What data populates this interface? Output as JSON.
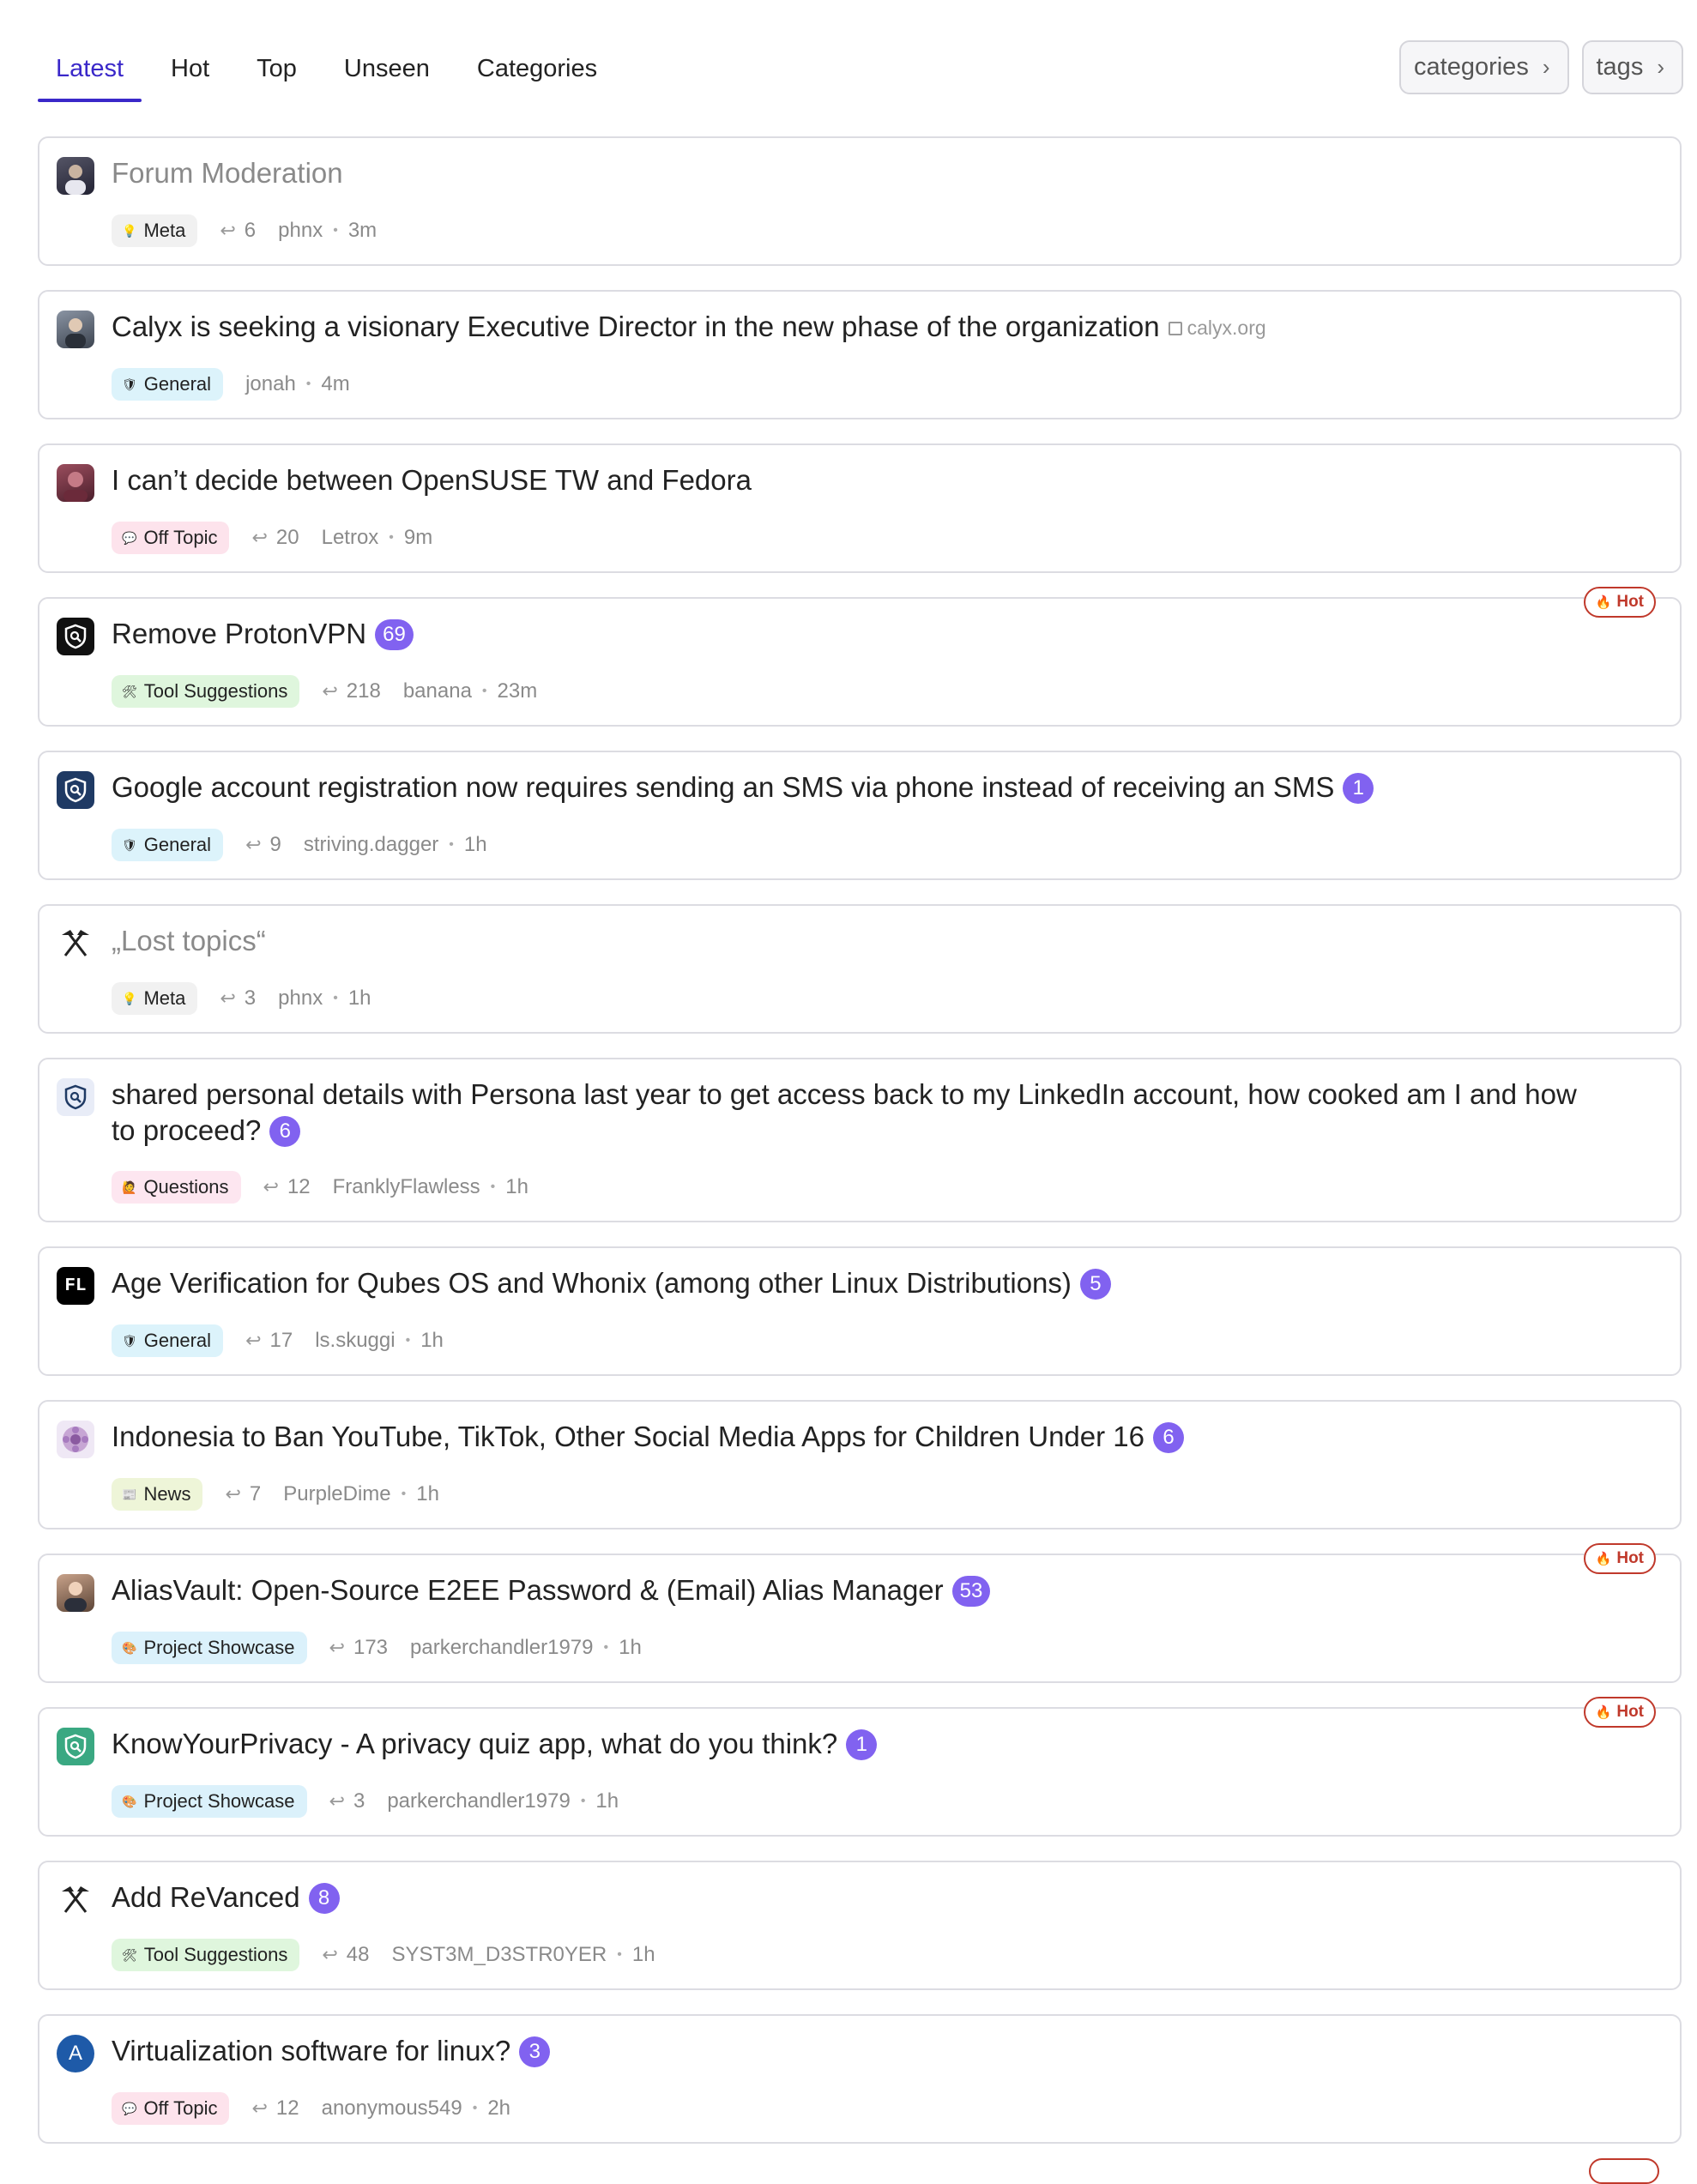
{
  "nav": {
    "tabs": [
      "Latest",
      "Hot",
      "Top",
      "Unseen",
      "Categories"
    ],
    "active_tab": "Latest",
    "filters": {
      "categories": "categories",
      "tags": "tags"
    }
  },
  "topics": [
    {
      "title": "Forum Moderation",
      "seen": true,
      "category": "Meta",
      "category_icon": "bulb-icon",
      "replies": "6",
      "user": "phnx",
      "age": "3m",
      "avatar": "person-avatar"
    },
    {
      "title": "Calyx is seeking a visionary Executive Director in the new phase of the organization",
      "link_domain": "calyx.org",
      "category": "General",
      "category_icon": "shield-icon",
      "user": "jonah",
      "age": "4m",
      "avatar": "person-avatar"
    },
    {
      "title": "I can’t decide between OpenSUSE TW and Fedora",
      "category": "Off Topic",
      "category_icon": "speech-bubble-icon",
      "replies": "20",
      "user": "Letrox",
      "age": "9m",
      "avatar": "person-avatar"
    },
    {
      "title": "Remove ProtonVPN",
      "badge": "69",
      "hot": "Hot",
      "category": "Tool Suggestions",
      "category_icon": "tools-icon",
      "replies": "218",
      "user": "banana",
      "age": "23m",
      "avatar": "privacyguides-logo"
    },
    {
      "title": "Google account registration now requires sending an SMS via phone instead of receiving an SMS",
      "badge": "1",
      "category": "General",
      "category_icon": "shield-icon",
      "replies": "9",
      "user": "striving.dagger",
      "age": "1h",
      "avatar": "privacyguides-logo"
    },
    {
      "title": "„Lost topics“",
      "seen": true,
      "category": "Meta",
      "category_icon": "bulb-icon",
      "replies": "3",
      "user": "phnx",
      "age": "1h",
      "avatar": "crossed-hammers-icon"
    },
    {
      "title": "shared personal details with Persona last year to get access back to my LinkedIn account, how cooked am I and how to proceed?",
      "badge": "6",
      "category": "Questions",
      "category_icon": "person-raising-hand-icon",
      "replies": "12",
      "user": "FranklyFlawless",
      "age": "1h",
      "avatar": "privacyguides-logo"
    },
    {
      "title": "Age Verification for Qubes OS and Whonix (among other Linux Distributions)",
      "badge": "5",
      "category": "General",
      "category_icon": "shield-icon",
      "replies": "17",
      "user": "ls.skuggi",
      "age": "1h",
      "avatar": "FL"
    },
    {
      "title": "Indonesia to Ban YouTube, TikTok, Other Social Media Apps for Children Under 16",
      "badge": "6",
      "category": "News",
      "category_icon": "newspaper-icon",
      "replies": "7",
      "user": "PurpleDime",
      "age": "1h",
      "avatar": "flower-avatar"
    },
    {
      "title": "AliasVault: Open-Source E2EE Password & (Email) Alias Manager",
      "badge": "53",
      "hot": "Hot",
      "category": "Project Showcase",
      "category_icon": "palette-icon",
      "replies": "173",
      "user": "parkerchandler1979",
      "age": "1h",
      "avatar": "person-avatar"
    },
    {
      "title": "KnowYourPrivacy - A privacy quiz app, what do you think?",
      "badge": "1",
      "hot": "Hot",
      "category": "Project Showcase",
      "category_icon": "palette-icon",
      "replies": "3",
      "user": "parkerchandler1979",
      "age": "1h",
      "avatar": "privacyguides-logo"
    },
    {
      "title": "Add ReVanced",
      "badge": "8",
      "category": "Tool Suggestions",
      "category_icon": "tools-icon",
      "replies": "48",
      "user": "SYST3M_D3STR0YER",
      "age": "1h",
      "avatar": "crossed-hammers-icon"
    },
    {
      "title": "Virtualization software for linux?",
      "badge": "3",
      "category": "Off Topic",
      "category_icon": "speech-bubble-icon",
      "replies": "12",
      "user": "anonymous549",
      "age": "2h",
      "avatar": "A"
    }
  ],
  "colors": {
    "accent": "#3a28c9",
    "badge": "#8162f0",
    "hot": "#c0392b"
  }
}
